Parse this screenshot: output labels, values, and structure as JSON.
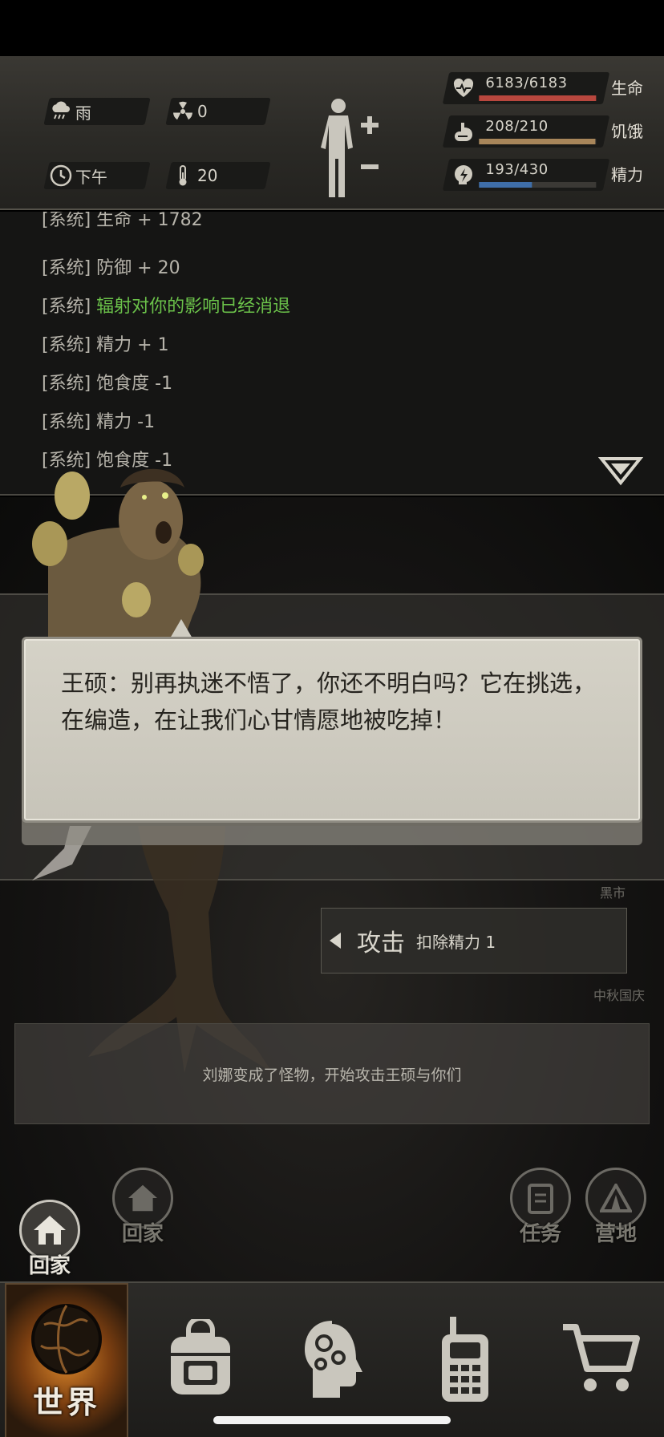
{
  "header": {
    "weather": {
      "icon": "rain-cloud-icon",
      "label": "雨"
    },
    "radiation": {
      "icon": "radiation-icon",
      "value": "0"
    },
    "time": {
      "icon": "clock-icon",
      "label": "下午"
    },
    "temperature": {
      "icon": "thermometer-icon",
      "value": "20"
    },
    "vitals": [
      {
        "icon": "heart-icon",
        "value": "6183/6183",
        "label": "生命",
        "fraction": 1.0,
        "color": "#b8473e"
      },
      {
        "icon": "stomach-icon",
        "value": "208/210",
        "label": "饥饿",
        "fraction": 0.99,
        "color": "#a8865a"
      },
      {
        "icon": "brain-bolt-icon",
        "value": "193/430",
        "label": "精力",
        "fraction": 0.45,
        "color": "#3f6ea8"
      }
    ]
  },
  "log": {
    "lines": [
      {
        "prefix": "[系统]",
        "text": "生命 + 1782",
        "highlight": false
      },
      {
        "prefix": "[系统]",
        "text": "防御 + 20",
        "highlight": false
      },
      {
        "prefix": "[系统]",
        "text": "辐射对你的影响已经消退",
        "highlight": true
      },
      {
        "prefix": "[系统]",
        "text": "精力 + 1",
        "highlight": false
      },
      {
        "prefix": "[系统]",
        "text": "饱食度 -1",
        "highlight": false
      },
      {
        "prefix": "[系统]",
        "text": "精力 -1",
        "highlight": false
      },
      {
        "prefix": "[系统]",
        "text": "饱食度 -1",
        "highlight": false
      }
    ]
  },
  "dialog": {
    "text": "王硕：别再执迷不悟了，你还不明白吗？它在挑选，在编造，在让我们心甘情愿地被吃掉！"
  },
  "action": {
    "attack_label": "攻击",
    "attack_cost": "扣除精力 1"
  },
  "scene": {
    "labels": {
      "black_market": "黑市",
      "festival": "中秋国庆"
    },
    "message": "刘娜变成了怪物，开始攻击王硕与你们",
    "icons": {
      "home_main": "回家",
      "home": "回家",
      "task": "任务",
      "camp": "营地"
    }
  },
  "nav": {
    "world": "世界",
    "items": [
      "backpack-icon",
      "skills-head-icon",
      "radio-icon",
      "cart-icon"
    ]
  },
  "colors": {
    "accent_green": "#6bc24a",
    "life": "#b8473e",
    "hunger": "#a8865a",
    "energy": "#3f6ea8"
  }
}
